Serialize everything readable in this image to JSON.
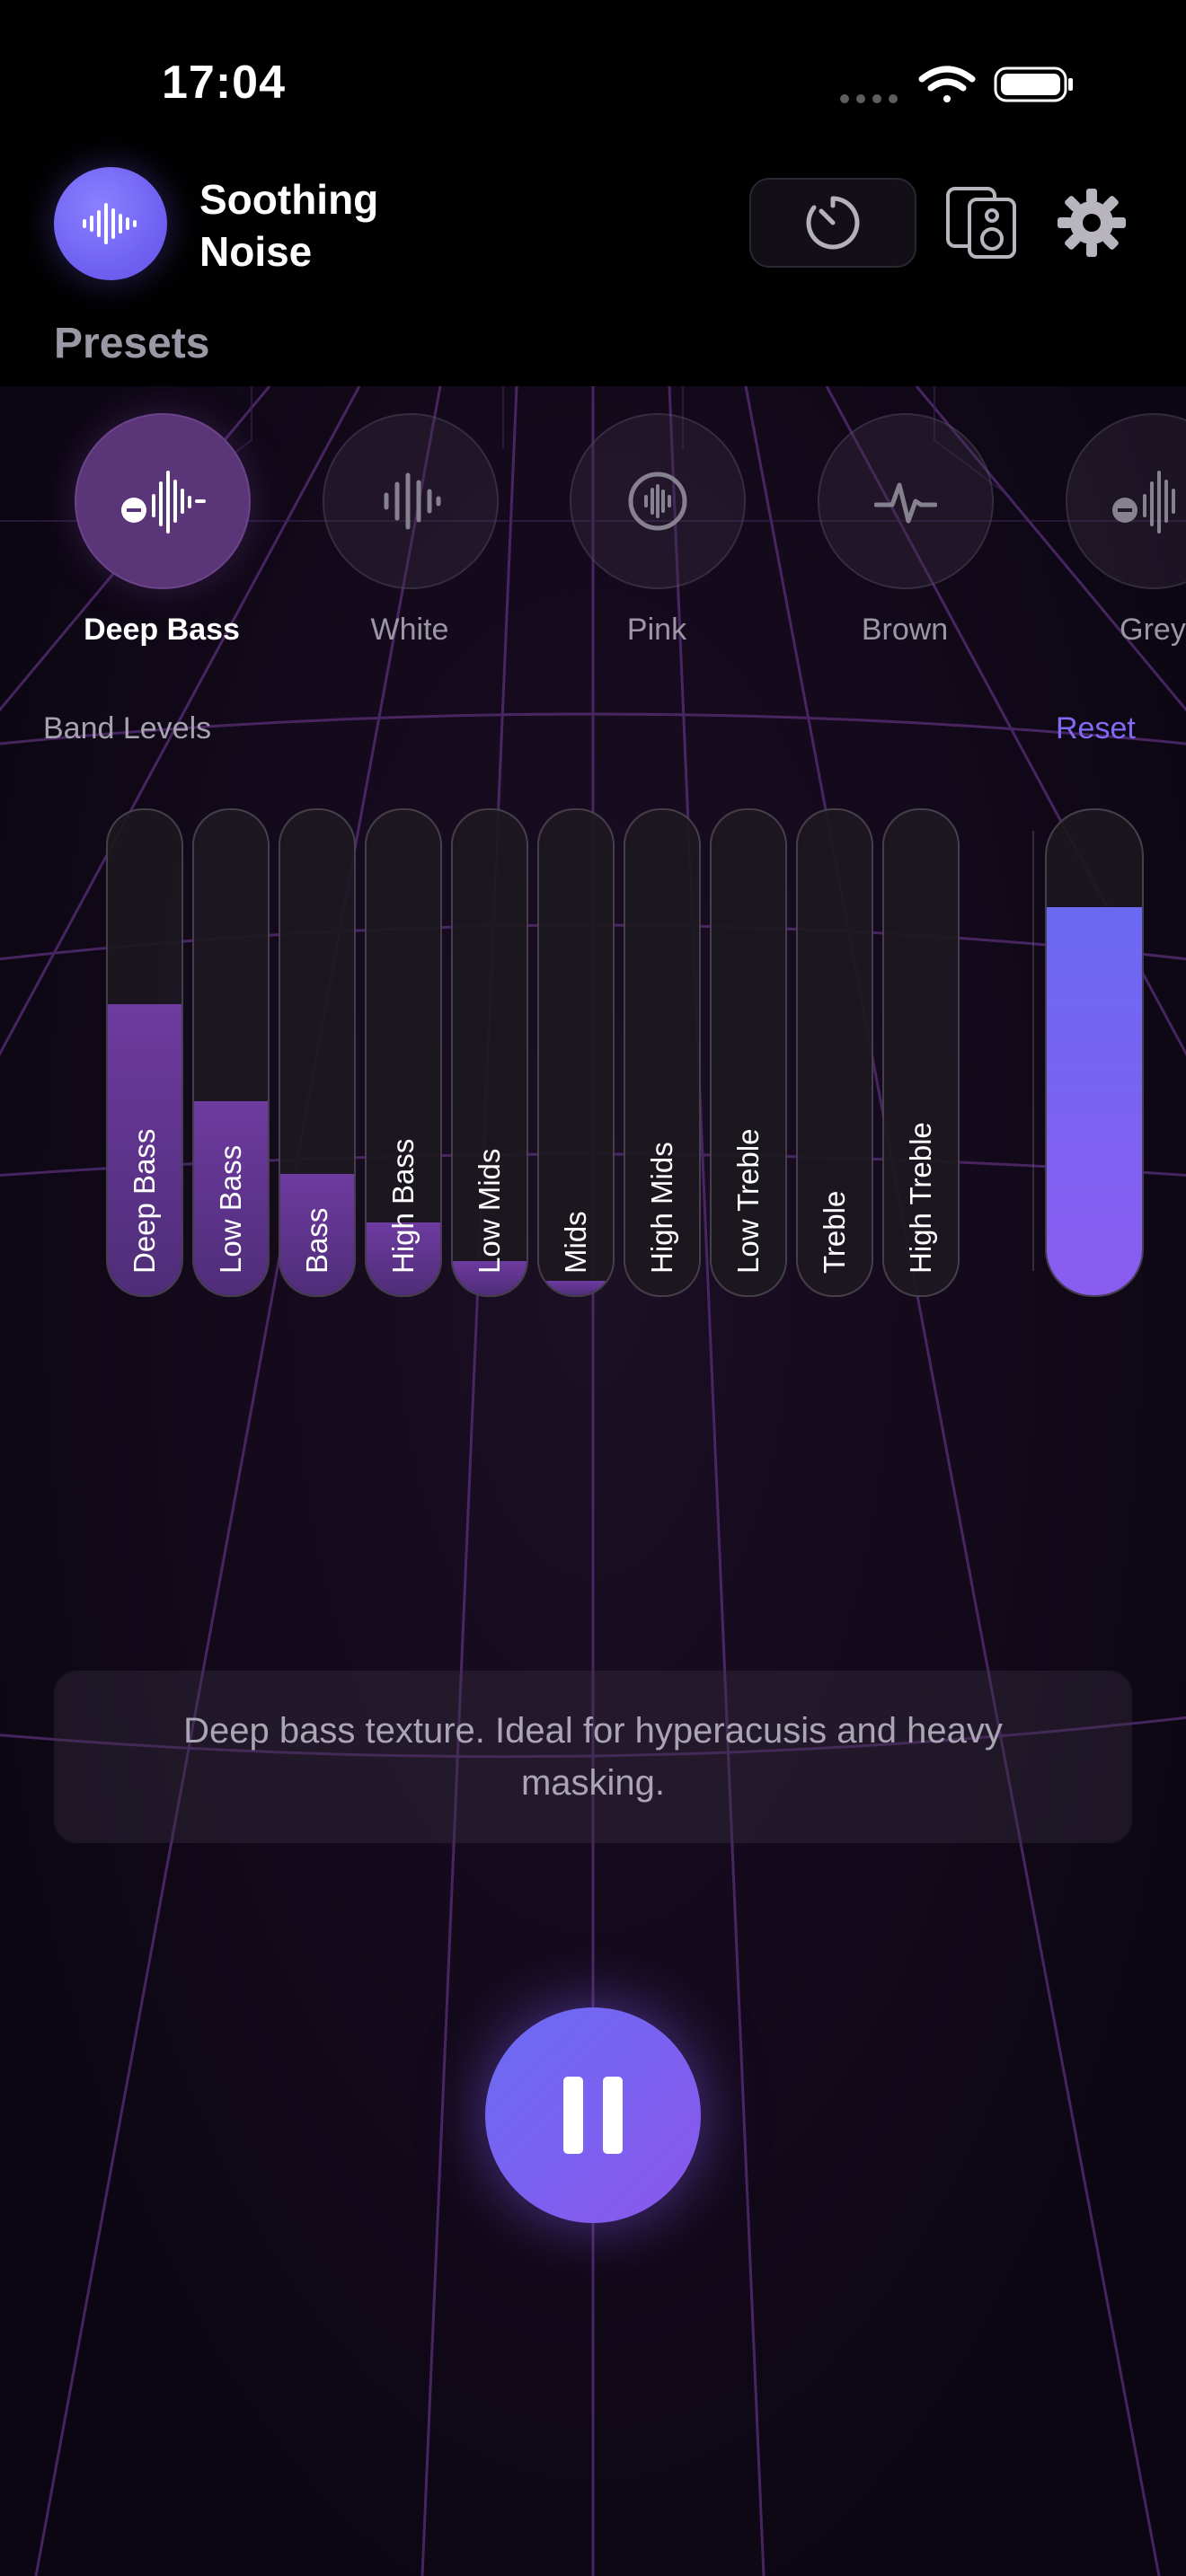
{
  "status_bar": {
    "time": "17:04",
    "icons": [
      "cellular-icon",
      "wifi-icon",
      "battery-icon"
    ]
  },
  "header": {
    "app_title": "Soothing Noise",
    "buttons": [
      "timer-icon",
      "speaker-icon",
      "gear-icon"
    ]
  },
  "presets": {
    "title": "Presets",
    "items": [
      {
        "label": "Deep Bass",
        "icon": "deep-bass-waveform-icon",
        "selected": true
      },
      {
        "label": "White",
        "icon": "white-noise-bars-icon",
        "selected": false
      },
      {
        "label": "Pink",
        "icon": "pink-noise-circle-icon",
        "selected": false
      },
      {
        "label": "Brown",
        "icon": "pulse-icon",
        "selected": false
      },
      {
        "label": "Grey",
        "icon": "grey-noise-icon",
        "selected": false
      }
    ]
  },
  "bands": {
    "title": "Band Levels",
    "reset_label": "Reset",
    "items": [
      {
        "label": "Deep Bass",
        "level": 0.6
      },
      {
        "label": "Low Bass",
        "level": 0.4
      },
      {
        "label": "Bass",
        "level": 0.25
      },
      {
        "label": "High Bass",
        "level": 0.15
      },
      {
        "label": "Low Mids",
        "level": 0.07
      },
      {
        "label": "Mids",
        "level": 0.03
      },
      {
        "label": "High Mids",
        "level": 0
      },
      {
        "label": "Low Treble",
        "level": 0
      },
      {
        "label": "Treble",
        "level": 0
      },
      {
        "label": "High Treble",
        "level": 0
      }
    ],
    "master_level": 0.8
  },
  "description": "Deep bass texture. Ideal for hyperacusis and heavy masking.",
  "playback": {
    "state": "playing",
    "button_icon": "pause-icon"
  },
  "colors": {
    "accent": "#6d5ef0",
    "band_fill": "#5c3585",
    "master_fill": "#7663f2",
    "link": "#7f6cf2"
  }
}
